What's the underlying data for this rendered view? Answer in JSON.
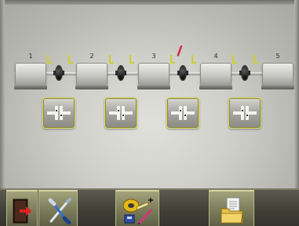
{
  "machine_train": {
    "machines": [
      {
        "label": "1"
      },
      {
        "label": "2"
      },
      {
        "label": "3"
      },
      {
        "label": "4"
      },
      {
        "label": "5"
      }
    ],
    "couplings": 4,
    "colors": {
      "foot_marker": "#cfcf2a",
      "pencil_marker": "#d9264a",
      "button_border": "#d8d86a"
    }
  },
  "coupling_buttons": [
    {
      "icon": "coupling-alignment-icon"
    },
    {
      "icon": "coupling-alignment-icon"
    },
    {
      "icon": "coupling-alignment-icon"
    },
    {
      "icon": "coupling-alignment-icon"
    }
  ],
  "toolbar": {
    "exit_icon": "exit-door-icon",
    "tools_icon": "screwdriver-wrench-icon",
    "edit_icon": "tape-measure-pencil-icon",
    "file_icon": "folder-document-icon"
  }
}
